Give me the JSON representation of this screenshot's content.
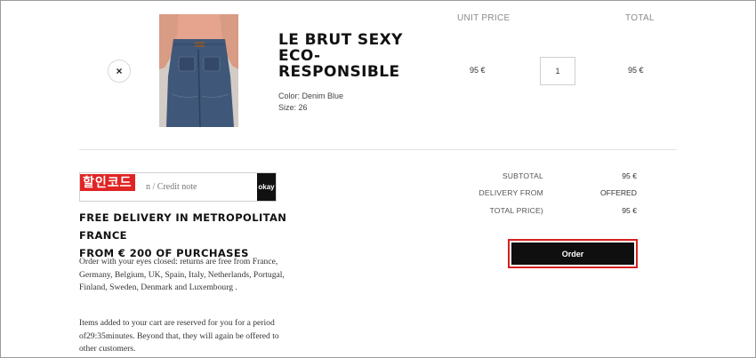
{
  "cart": {
    "headers": {
      "unit_price": "UNIT PRICE",
      "total": "TOTAL"
    },
    "remove_glyph": "×",
    "item": {
      "title": "LE BRUT SEXY ECO-RESPONSIBLE",
      "color": "Color: Denim Blue",
      "size": "Size: 26",
      "unit_price": "95 €",
      "quantity": "1",
      "total": "95 €"
    }
  },
  "discount": {
    "overlay_label": "할인코드",
    "placeholder": "n / Credit note",
    "button_label": "okay"
  },
  "info": {
    "free_delivery_line1": "FREE DELIVERY IN METROPOLITAN FRANCE",
    "free_delivery_line2": "FROM € 200 OF PURCHASES",
    "returns_text": "Order with your eyes closed: returns are free from France, Germany, Belgium, UK, Spain, Italy, Netherlands, Portugal, Finland, Sweden, Denmark and Luxembourg .",
    "reserved_text": "Items added to your cart are reserved for you for a period of29:35minutes. Beyond that, they will again be offered to other customers."
  },
  "summary": {
    "subtotal_label": "SUBTOTAL",
    "subtotal_value": "95 €",
    "delivery_label": "DELIVERY FROM",
    "delivery_value": "OFFERED",
    "total_label": "TOTAL PRICE)",
    "total_value": "95 €",
    "order_label": "Order"
  },
  "colors": {
    "highlight_red": "#d62020",
    "button_black": "#0f0f0f"
  }
}
